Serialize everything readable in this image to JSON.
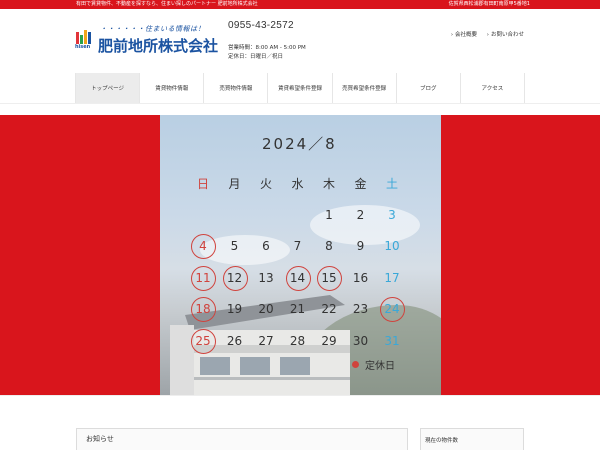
{
  "top_strip": {
    "left_text": "有田で賃貸物件、不動産を探すなら、住まい探しのパートナー 肥前地所株式会社",
    "right_text": "佐賀県西松浦郡有田町南原甲5番地1"
  },
  "logo": {
    "tagline": "・・・・・・住まいる情報は！",
    "mark_text": "hisen",
    "company_name": "肥前地所株式会社"
  },
  "contact": {
    "phone": "0955-43-2572",
    "hours": "営業時間：8:00 AM - 5:00 PM",
    "holidays": "定休日：日曜日／祝日"
  },
  "header_links": [
    {
      "label": "会社概要"
    },
    {
      "label": "お問い合わせ"
    }
  ],
  "nav": [
    {
      "label": "トップページ"
    },
    {
      "label": "賃貸物件情報"
    },
    {
      "label": "売買物件情報"
    },
    {
      "label": "賃貸希望条件登録"
    },
    {
      "label": "売買希望条件登録"
    },
    {
      "label": "ブログ"
    },
    {
      "label": "アクセス"
    }
  ],
  "calendar": {
    "title": "2024／8",
    "weekdays": [
      "日",
      "月",
      "火",
      "水",
      "木",
      "金",
      "土"
    ],
    "first_weekday": 4,
    "days_in_month": 31,
    "holidays": [
      4,
      11,
      12,
      14,
      15,
      18,
      24,
      25
    ],
    "legend_label": "定休日"
  },
  "news": {
    "title": "お知らせ"
  },
  "sidebar": {
    "title": "現在の物件数"
  },
  "colors": {
    "brand_red": "#d9151c",
    "brand_blue": "#1b53a1",
    "holiday_red": "#d0433d",
    "saturday_blue": "#3aa8d8"
  }
}
